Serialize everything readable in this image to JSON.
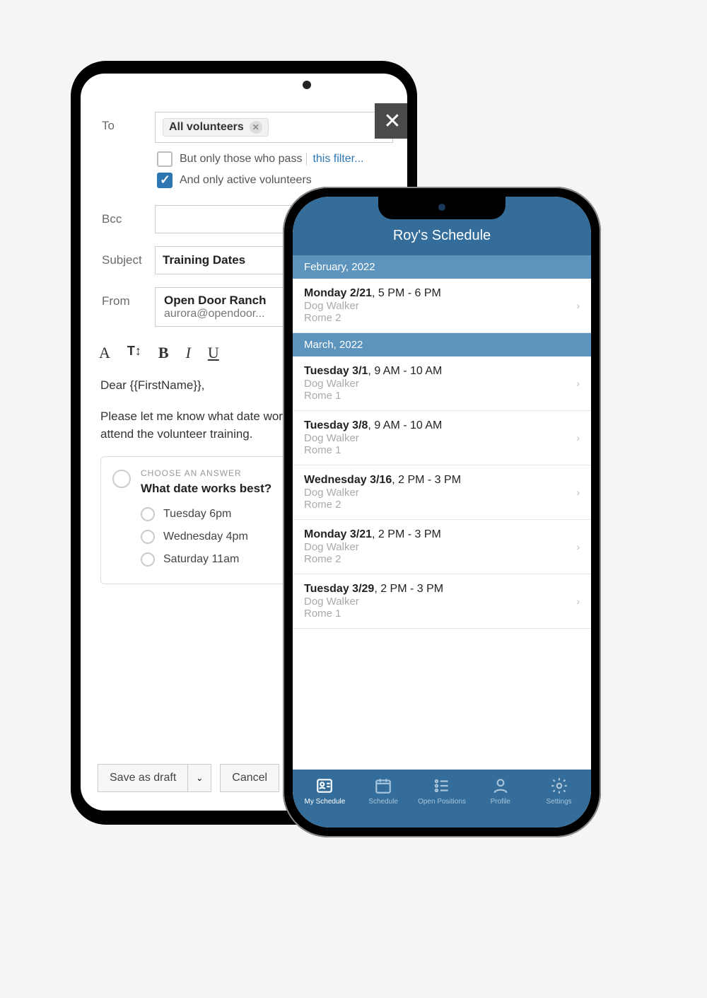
{
  "email": {
    "labels": {
      "to": "To",
      "bcc": "Bcc",
      "subject": "Subject",
      "from": "From"
    },
    "to_chip": "All volunteers",
    "filter_pass_text": "But only those who pass",
    "filter_link": "this filter...",
    "filter_active_text": "And only active volunteers",
    "subject_value": "Training Dates",
    "from_name": "Open Door Ranch",
    "from_email": "aurora@opendoor...",
    "body_greeting": "Dear {{FirstName}},",
    "body_para": "Please let me know what date works best for you to attend the volunteer training.",
    "poll_caption": "CHOOSE AN ANSWER",
    "poll_question": "What date works best?",
    "poll_options": [
      "Tuesday 6pm",
      "Wednesday 4pm",
      "Saturday 11am"
    ],
    "save_draft": "Save as draft",
    "cancel": "Cancel"
  },
  "schedule": {
    "title": "Roy's Schedule",
    "months": [
      {
        "label": "February, 2022",
        "items": [
          {
            "date": "Monday 2/21",
            "time": "5 PM - 6 PM",
            "role": "Dog Walker",
            "room": "Rome 2"
          }
        ]
      },
      {
        "label": "March, 2022",
        "items": [
          {
            "date": "Tuesday 3/1",
            "time": "9 AM - 10 AM",
            "role": "Dog Walker",
            "room": "Rome 1"
          },
          {
            "date": "Tuesday 3/8",
            "time": "9 AM - 10 AM",
            "role": "Dog Walker",
            "room": "Rome 1"
          },
          {
            "date": "Wednesday 3/16",
            "time": "2 PM - 3 PM",
            "role": "Dog Walker",
            "room": "Rome 2"
          },
          {
            "date": "Monday 3/21",
            "time": "2 PM - 3 PM",
            "role": "Dog Walker",
            "room": "Rome 2"
          },
          {
            "date": "Tuesday 3/29",
            "time": "2 PM - 3 PM",
            "role": "Dog Walker",
            "room": "Rome 1"
          }
        ]
      }
    ],
    "tabs": [
      "My Schedule",
      "Schedule",
      "Open Positions",
      "Profile",
      "Settings"
    ]
  }
}
